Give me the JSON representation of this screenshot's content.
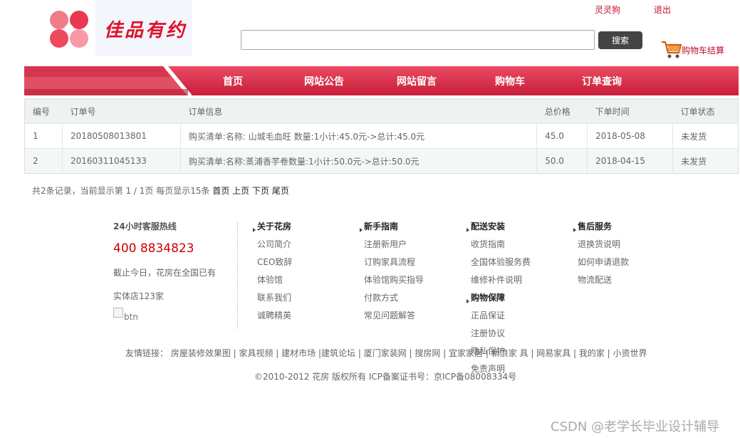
{
  "header": {
    "logo_text": "佳品有约",
    "user_link": "灵灵狗",
    "logout_link": "退出",
    "search_placeholder": "",
    "search_button": "搜索",
    "cart_label": "购物车结算"
  },
  "nav": [
    "首页",
    "网站公告",
    "网站留言",
    "购物车",
    "订单查询"
  ],
  "orders": {
    "columns": [
      "编号",
      "订单号",
      "订单信息",
      "总价格",
      "下单时间",
      "订单状态"
    ],
    "rows": [
      [
        "1",
        "20180508013801",
        "购买清单:名称: 山城毛血旺 数量:1小计:45.0元->总计:45.0元",
        "45.0",
        "2018-05-08",
        "未发货"
      ],
      [
        "2",
        "20160311045133",
        "购买清单:名称:蒸浦香芋卷数量:1小计:50.0元->总计:50.0元",
        "50.0",
        "2018-04-15",
        "未发货"
      ]
    ]
  },
  "pager": {
    "summary": "共2条记录，当前显示第 1 / 1页 每页显示15条",
    "first": "首页",
    "prev": "上页",
    "next": "下页",
    "last": "尾页"
  },
  "footer": {
    "hotline_title": "24小时客服热线",
    "hotline_number": "400 8834823",
    "note1": "截止今日，花房在全国已有",
    "note2": "实体店123家",
    "btn_alt": "btn",
    "columns": [
      {
        "title": "关于花房",
        "items": [
          "公司简介",
          "CEO致辞",
          "体验馆",
          "联系我们",
          "诚聘精英"
        ]
      },
      {
        "title": "新手指南",
        "items": [
          "注册新用户",
          "订购家具流程",
          "体验馆购买指导",
          "付款方式",
          "常见问题解答"
        ]
      },
      {
        "title": "配送安装",
        "items": [
          "收货指南",
          "全国体验服务费",
          "维修补件说明"
        ]
      },
      {
        "title": "售后服务",
        "items": [
          "退换货说明",
          "如何申请退款",
          "物流配送"
        ]
      }
    ],
    "guarantee": {
      "title": "购物保障",
      "items": [
        "正品保证",
        "注册协议",
        "隐私保护",
        "免责声明"
      ]
    },
    "friends": "友情链接： 房屋装修效果图 | 家具视频 | 建材市场 |建筑论坛 | 厦门家装网 | 搜房网 | 宜家家居 | 新浪家 具 | 网易家具 | 我的家 | 小资世界",
    "copyright": "©2010-2012 花房 版权所有 ICP备案证书号：京ICP备08008334号"
  },
  "watermark": "CSDN @老学长毕业设计辅导"
}
